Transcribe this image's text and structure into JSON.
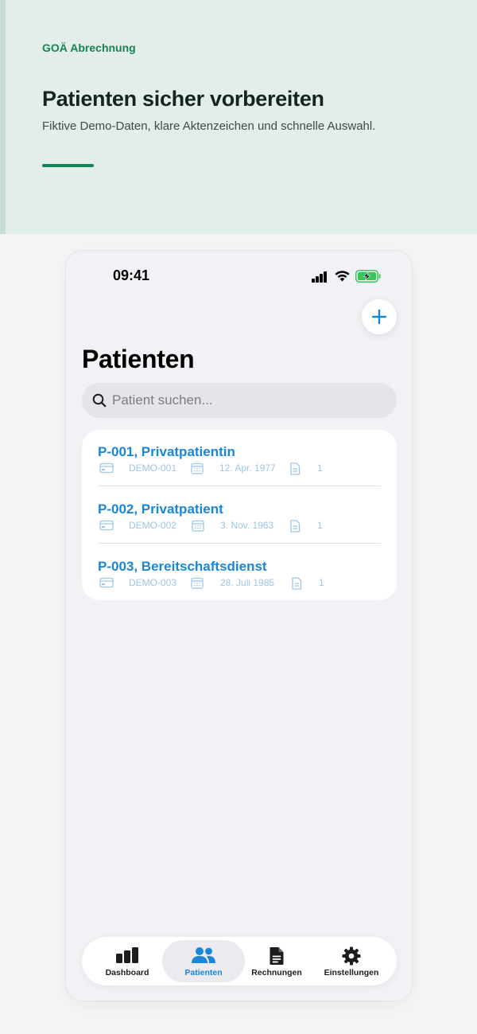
{
  "hero": {
    "eyebrow": "GOÄ Abrechnung",
    "title": "Patienten sicher vorbereiten",
    "subtitle": "Fiktive Demo-Daten, klare Aktenzeichen und schnelle Auswahl."
  },
  "status_bar": {
    "time": "09:41"
  },
  "page": {
    "title": "Patienten"
  },
  "search": {
    "placeholder": "Patient suchen..."
  },
  "patients": [
    {
      "name": "P-001, Privatpatientin",
      "file_id": "DEMO-001",
      "birth_date": "12. Apr. 1977",
      "invoice_count": "1"
    },
    {
      "name": "P-002, Privatpatient",
      "file_id": "DEMO-002",
      "birth_date": "3. Nov. 1963",
      "invoice_count": "1"
    },
    {
      "name": "P-003, Bereitschaftsdienst",
      "file_id": "DEMO-003",
      "birth_date": "28. Juli 1985",
      "invoice_count": "1"
    }
  ],
  "tabs": [
    {
      "label": "Dashboard",
      "icon": "chart-bars-icon",
      "active": false
    },
    {
      "label": "Patienten",
      "icon": "people-icon",
      "active": true
    },
    {
      "label": "Rechnungen",
      "icon": "document-icon",
      "active": false
    },
    {
      "label": "Einstellungen",
      "icon": "gear-icon",
      "active": false
    }
  ],
  "colors": {
    "accent_green": "#17825a",
    "accent_blue": "#1a86d8",
    "meta_blue": "#9ec6e6",
    "hero_bg": "#e3eee9",
    "screen_bg": "#f2f2f6"
  }
}
